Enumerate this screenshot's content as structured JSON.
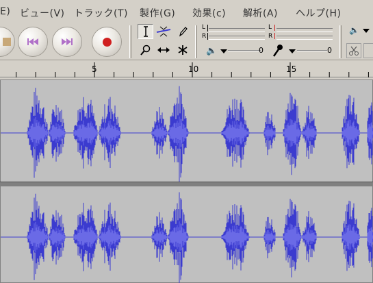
{
  "menu": {
    "items": [
      {
        "label": "E)"
      },
      {
        "label": "ビュー(V)"
      },
      {
        "label": "トラック(T)"
      },
      {
        "label": "製作(G)"
      },
      {
        "label": "効果(c)"
      },
      {
        "label": "解析(A)"
      },
      {
        "label": "ヘルプ(H)"
      }
    ]
  },
  "toolbar": {
    "meter": {
      "left_label": "L",
      "right_label": "R"
    },
    "output_volume": "0",
    "input_volume": "0",
    "icons": {
      "stop": "stop-icon",
      "skip_start": "skip-to-start-icon",
      "skip_end": "skip-to-end-icon",
      "record": "record-icon",
      "selection": "selection-tool-icon",
      "envelope": "envelope-tool-icon",
      "draw": "pencil-icon",
      "zoom": "zoom-icon",
      "timeshift": "time-shift-icon",
      "multi": "multi-tool-icon",
      "speaker": "speaker-icon",
      "microphone": "microphone-icon",
      "cut": "scissors-icon"
    }
  },
  "ruler": {
    "labels": [
      "5",
      "10",
      "15"
    ]
  },
  "colors": {
    "waveform": "#3b3bcf",
    "waveform_rms": "#6a6ae6",
    "track_bg": "#c0c0c0",
    "window_bg": "#d4d0c8",
    "record": "#d02020",
    "transport_icon": "#b070c8"
  }
}
